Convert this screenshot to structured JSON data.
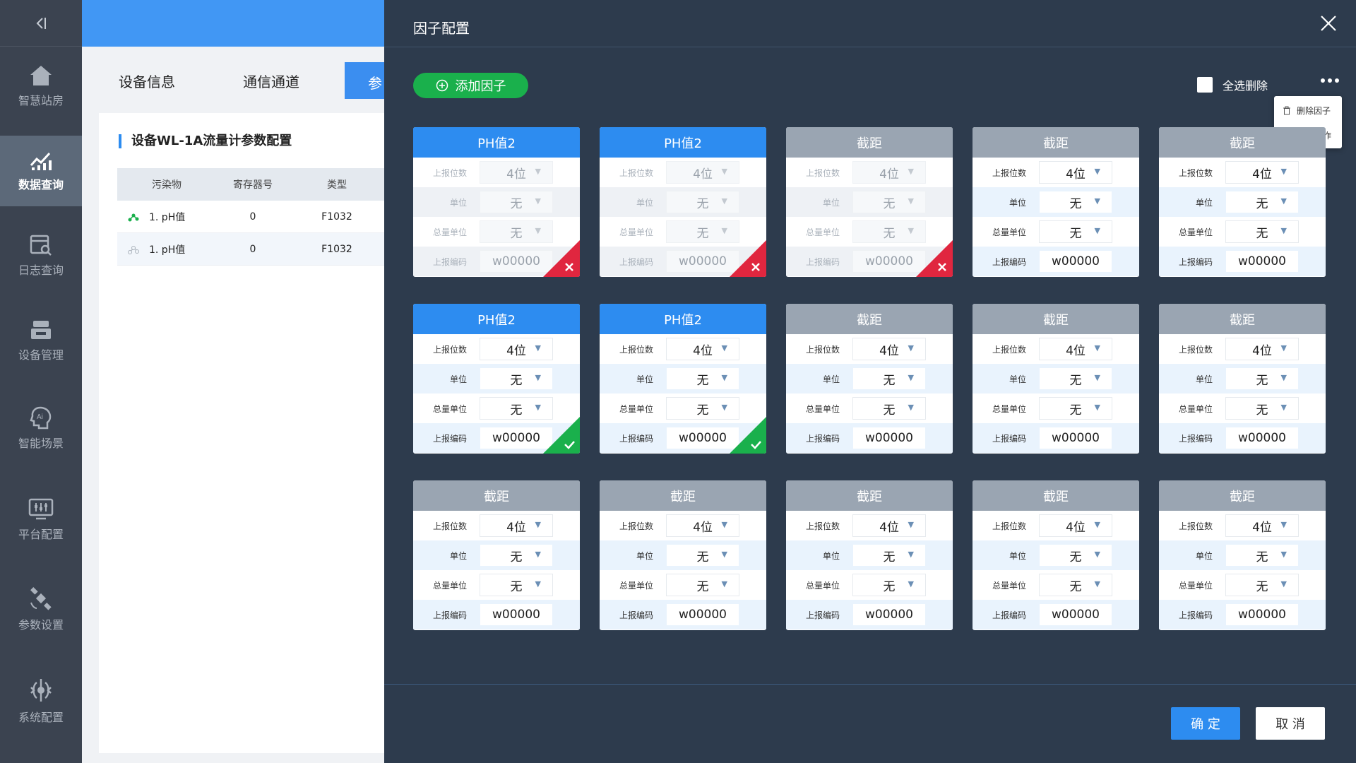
{
  "sidebar": {
    "items": [
      {
        "label": "智慧站房",
        "icon": "home-icon"
      },
      {
        "label": "数据查询",
        "icon": "chart-icon",
        "active": true
      },
      {
        "label": "日志查询",
        "icon": "log-search-icon"
      },
      {
        "label": "设备管理",
        "icon": "device-icon"
      },
      {
        "label": "智能场景",
        "icon": "ai-head-icon"
      },
      {
        "label": "平台配置",
        "icon": "monitor-sliders-icon"
      },
      {
        "label": "参数设置",
        "icon": "satellite-icon"
      },
      {
        "label": "系统配置",
        "icon": "gear-icon"
      }
    ]
  },
  "background": {
    "tabs": [
      "设备信息",
      "通信通道",
      "参"
    ],
    "panel_title": "设备WL-1A流量计参数配置",
    "table": {
      "headers": [
        "污染物",
        "寄存器号",
        "类型"
      ],
      "rows": [
        {
          "name": "1. pH值",
          "register": "0",
          "type": "F1032"
        },
        {
          "name": "1. pH值",
          "register": "0",
          "type": "F1032"
        }
      ]
    }
  },
  "modal": {
    "title": "因子配置",
    "add_button": "添加因子",
    "select_all_delete": "全选删除",
    "menu": [
      "删除因子",
      "其他操作"
    ],
    "row_labels": [
      "上报位数",
      "单位",
      "总量单位",
      "上报编码"
    ],
    "cards": [
      {
        "title": "PH值2",
        "header": "blue",
        "state": "disabled",
        "badge": "x",
        "values": [
          "4位",
          "无",
          "无",
          "w00000"
        ]
      },
      {
        "title": "PH值2",
        "header": "blue",
        "state": "disabled",
        "badge": "x",
        "values": [
          "4位",
          "无",
          "无",
          "w00000"
        ]
      },
      {
        "title": "截距",
        "header": "gray",
        "state": "disabled",
        "badge": "x",
        "values": [
          "4位",
          "无",
          "无",
          "w00000"
        ]
      },
      {
        "title": "截距",
        "header": "gray",
        "state": "normal",
        "badge": "",
        "values": [
          "4位",
          "无",
          "无",
          "w00000"
        ]
      },
      {
        "title": "截距",
        "header": "gray",
        "state": "normal",
        "badge": "",
        "values": [
          "4位",
          "无",
          "无",
          "w00000"
        ]
      },
      {
        "title": "PH值2",
        "header": "blue",
        "state": "normal",
        "badge": "check",
        "values": [
          "4位",
          "无",
          "无",
          "w00000"
        ]
      },
      {
        "title": "PH值2",
        "header": "blue",
        "state": "normal",
        "badge": "check",
        "values": [
          "4位",
          "无",
          "无",
          "w00000"
        ]
      },
      {
        "title": "截距",
        "header": "gray",
        "state": "normal",
        "badge": "",
        "values": [
          "4位",
          "无",
          "无",
          "w00000"
        ]
      },
      {
        "title": "截距",
        "header": "gray",
        "state": "normal",
        "badge": "",
        "values": [
          "4位",
          "无",
          "无",
          "w00000"
        ]
      },
      {
        "title": "截距",
        "header": "gray",
        "state": "normal",
        "badge": "",
        "values": [
          "4位",
          "无",
          "无",
          "w00000"
        ]
      },
      {
        "title": "截距",
        "header": "gray",
        "state": "normal",
        "badge": "",
        "values": [
          "4位",
          "无",
          "无",
          "w00000"
        ]
      },
      {
        "title": "截距",
        "header": "gray",
        "state": "normal",
        "badge": "",
        "values": [
          "4位",
          "无",
          "无",
          "w00000"
        ]
      },
      {
        "title": "截距",
        "header": "gray",
        "state": "normal",
        "badge": "",
        "values": [
          "4位",
          "无",
          "无",
          "w00000"
        ]
      },
      {
        "title": "截距",
        "header": "gray",
        "state": "normal",
        "badge": "",
        "values": [
          "4位",
          "无",
          "无",
          "w00000"
        ]
      },
      {
        "title": "截距",
        "header": "gray",
        "state": "normal",
        "badge": "",
        "values": [
          "4位",
          "无",
          "无",
          "w00000"
        ]
      }
    ],
    "confirm": "确 定",
    "cancel": "取 消"
  },
  "colors": {
    "primary": "#2d8cf0",
    "success": "#1ab04c",
    "danger": "#e0263f",
    "modal_bg": "#2d3b4d",
    "sidebar_bg": "#3b4350"
  }
}
